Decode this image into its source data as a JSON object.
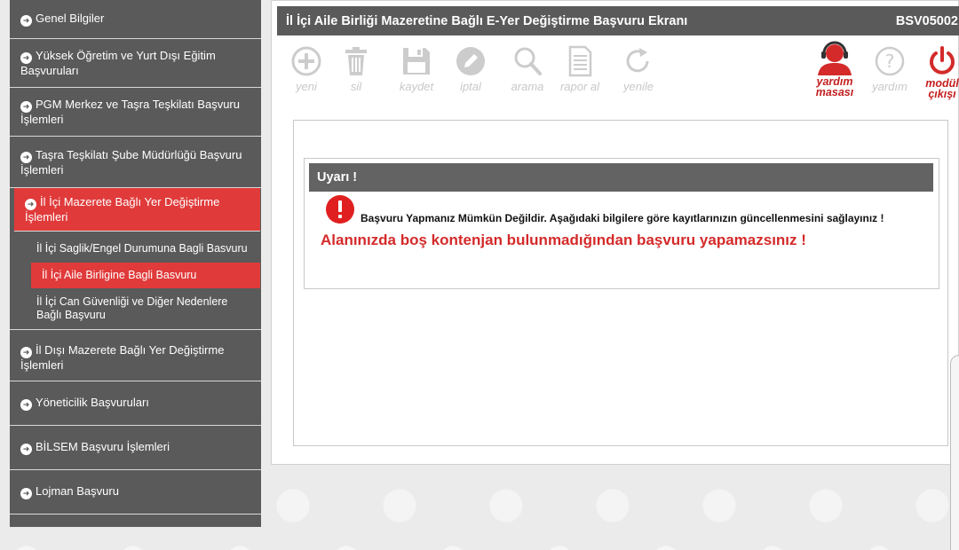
{
  "sidebar": {
    "items": [
      {
        "label": "Genel Bilgiler"
      },
      {
        "label": "Yüksek Öğretim ve Yurt Dışı Eğitim Başvuruları"
      },
      {
        "label": "PGM Merkez ve Taşra Teşkilatı Başvuru İşlemleri"
      },
      {
        "label": "Taşra Teşkilatı Şube Müdürlüğü Başvuru İşlemleri"
      },
      {
        "label": "İl İçi Mazerete Bağlı Yer Değiştirme İşlemleri"
      },
      {
        "label": "İl Dışı Mazerete Bağlı Yer Değiştirme İşlemleri"
      },
      {
        "label": "Yöneticilik Başvuruları"
      },
      {
        "label": "BİLSEM Başvuru İşlemleri"
      },
      {
        "label": "Lojman Başvuru"
      }
    ],
    "submenu": [
      {
        "label": "İl İçi Saglik/Engel Durumuna Bagli Basvuru"
      },
      {
        "label": "İl İçi Aile Birligine Bagli Basvuru"
      },
      {
        "label": "İl İçi Can Güvenliği ve Diğer Nedenlere Bağlı Başvuru"
      }
    ]
  },
  "header": {
    "title": "İl İçi Aile Birliği Mazeretine Bağlı  E-Yer Değiştirme Başvuru Ekranı",
    "code": "BSV05002"
  },
  "toolbar": {
    "new_label": "yeni",
    "delete_label": "sil",
    "save_label": "kaydet",
    "cancel_label": "iptal",
    "search_label": "arama",
    "report_label": "rapor al",
    "refresh_label": "yenile",
    "helpdesk_label_1": "yardım",
    "helpdesk_label_2": "masası",
    "help_label": "yardım",
    "exit_label_1": "modül",
    "exit_label_2": "çıkışı"
  },
  "alert": {
    "title": "Uyarı !",
    "message": "Başvuru Yapmanız Mümkün Değildir. Aşağıdaki bilgilere göre kayıtlarınızın güncellenmesini sağlayınız !",
    "error": "Alanınızda boş kontenjan bulunmadığından başvuru yapamazsınız !"
  },
  "colors": {
    "accent_red": "#e03a3a",
    "sidebar_bg": "#5a5a5a",
    "disabled_icon": "#cccccc",
    "error_text": "#d42a2a"
  }
}
